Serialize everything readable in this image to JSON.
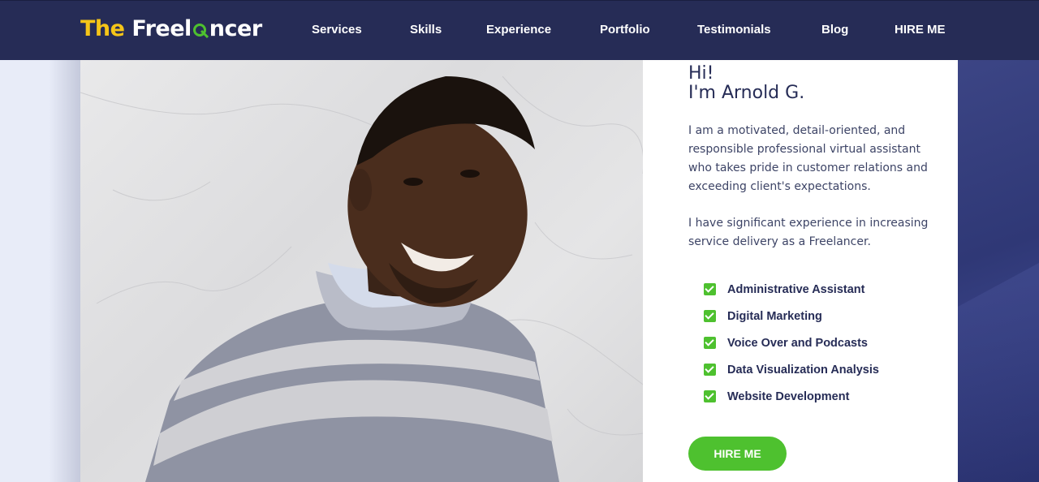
{
  "brand": {
    "logo_the": "The",
    "logo_free": "Freel",
    "logo_end": "ncer"
  },
  "nav": [
    {
      "label": "Services"
    },
    {
      "label": "Skills"
    },
    {
      "label": "Experience"
    },
    {
      "label": "Portfolio"
    },
    {
      "label": "Testimonials"
    },
    {
      "label": "Blog"
    },
    {
      "label": "HIRE ME"
    }
  ],
  "hero": {
    "greeting_line1": "Hi!",
    "greeting_line2": "I'm Arnold G.",
    "paragraph1": "I am a motivated, detail-oriented, and responsible professional virtual assistant who takes pride in customer relations and exceeding client's expectations.",
    "paragraph2": "I have significant experience in increasing service delivery as a Freelancer.",
    "skills": [
      {
        "label": "Administrative Assistant"
      },
      {
        "label": "Digital Marketing"
      },
      {
        "label": "Voice Over and Podcasts"
      },
      {
        "label": "Data Visualization Analysis"
      },
      {
        "label": "Website Development"
      }
    ],
    "cta_label": "HIRE ME"
  },
  "colors": {
    "header_bg": "#262c56",
    "accent_green": "#4ec12f",
    "logo_yellow": "#f5c518",
    "text_dark": "#262c56"
  }
}
